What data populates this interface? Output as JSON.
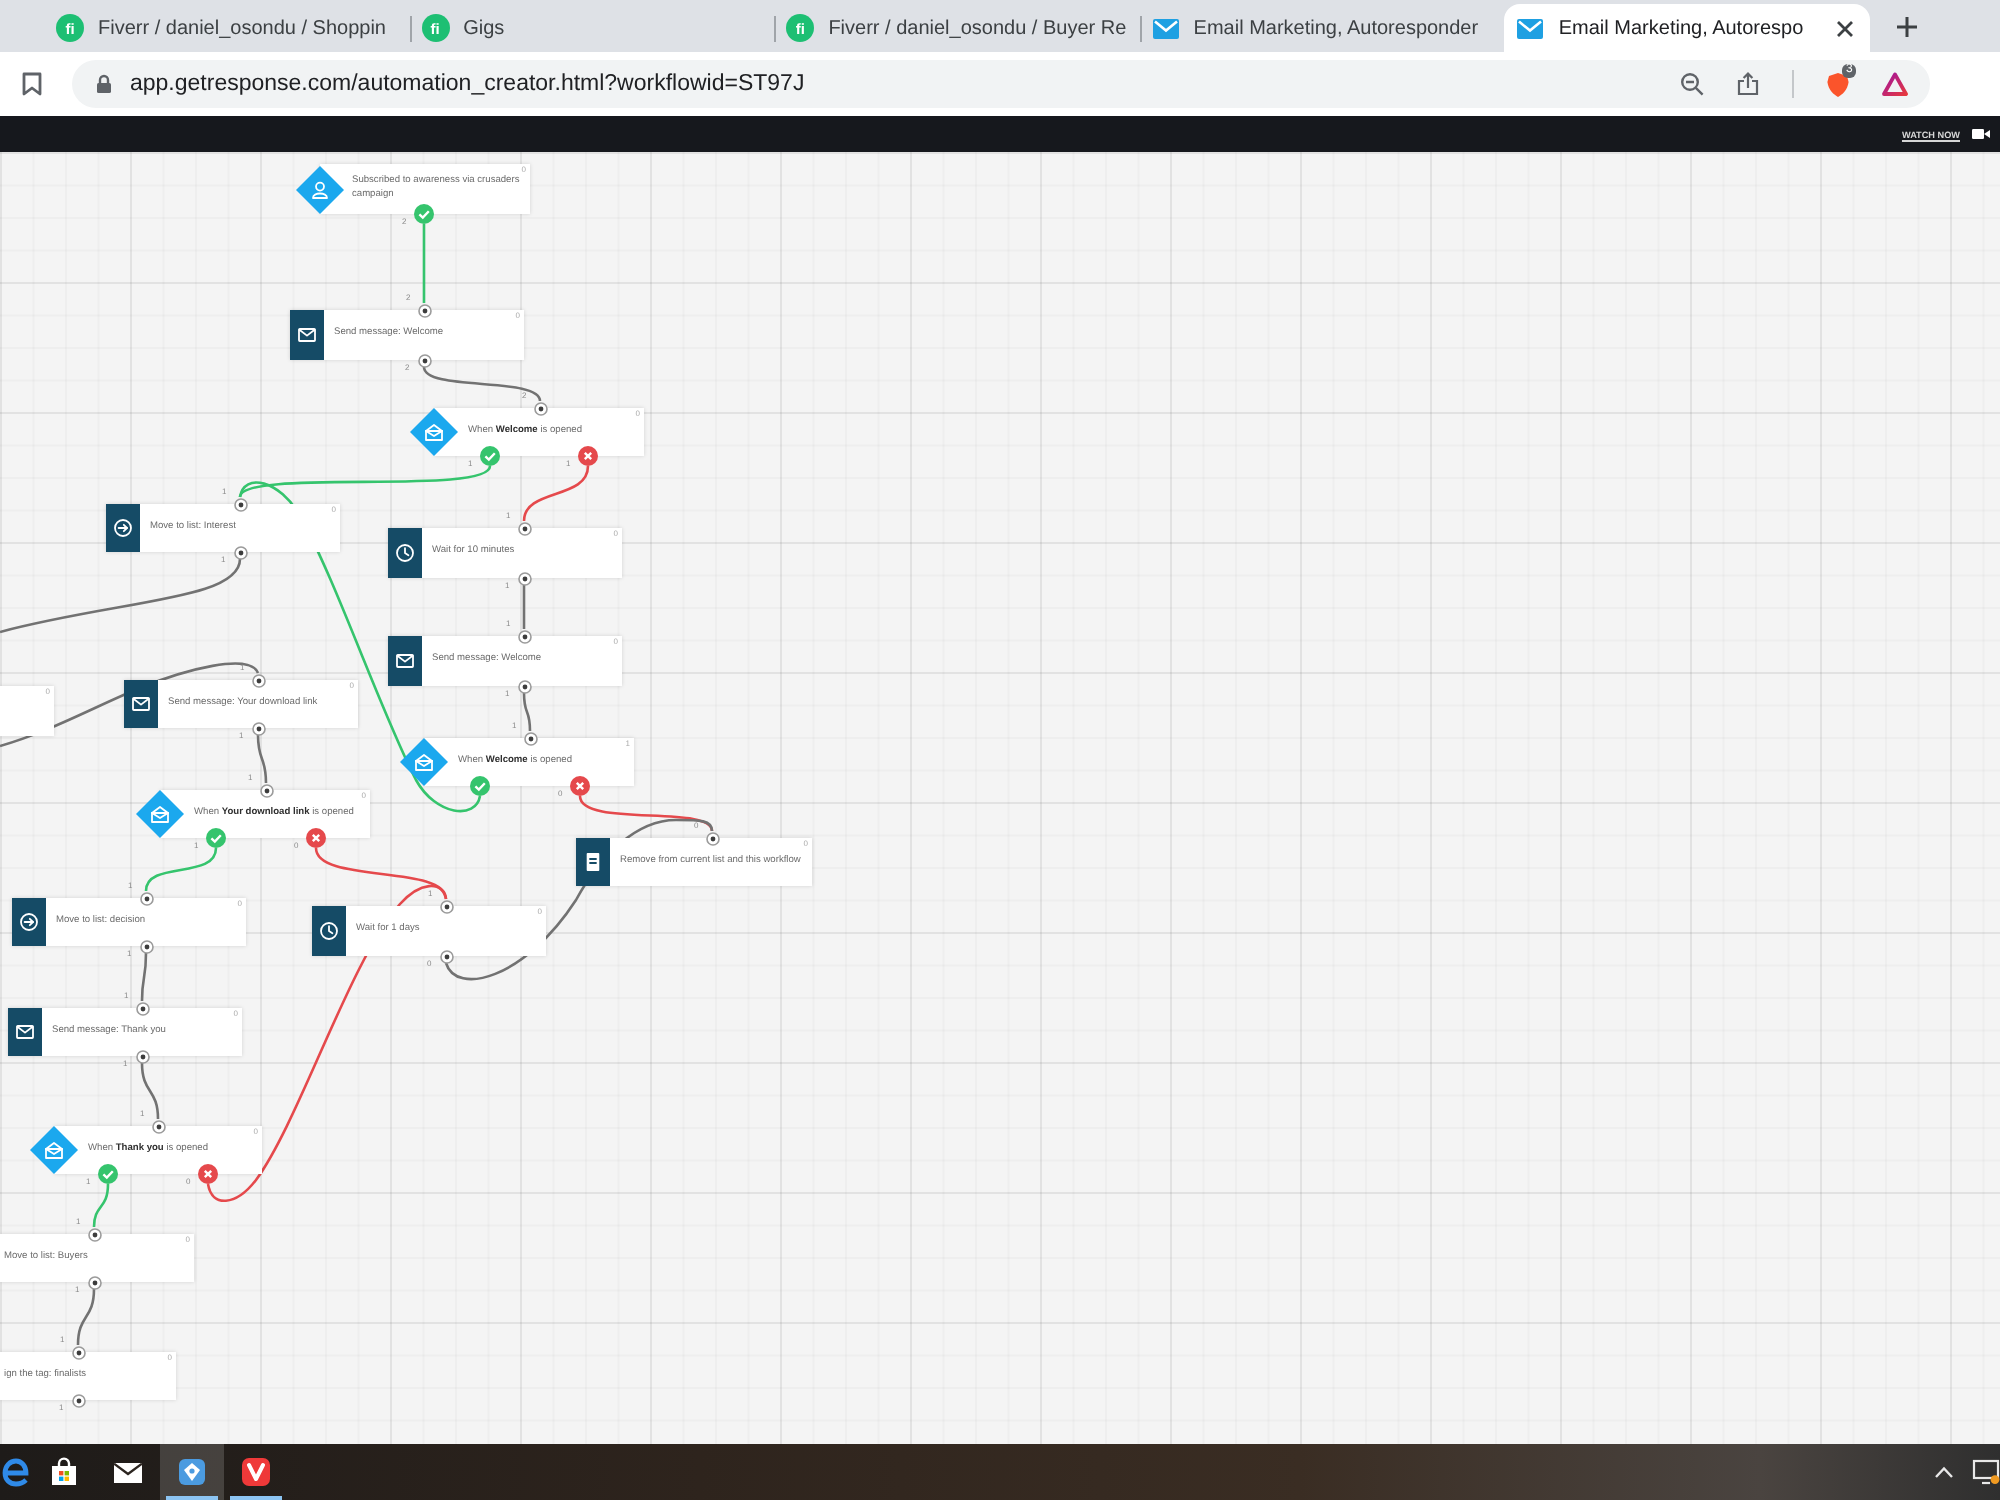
{
  "browser": {
    "tabs": [
      {
        "title": "Fiverr / daniel_osondu / Shoppin",
        "favicon": {
          "kind": "badge",
          "text": "fi"
        },
        "selected": false
      },
      {
        "title": "Gigs",
        "favicon": {
          "kind": "badge",
          "text": "fi"
        },
        "selected": false
      },
      {
        "title": "Fiverr / daniel_osondu / Buyer Re",
        "favicon": {
          "kind": "badge",
          "text": "fi"
        },
        "selected": false
      },
      {
        "title": "Email Marketing, Autoresponder",
        "favicon": {
          "kind": "envelope"
        },
        "selected": false
      },
      {
        "title": "Email Marketing, Autorespo",
        "favicon": {
          "kind": "envelope"
        },
        "selected": true
      }
    ],
    "address_bar": {
      "url": "app.getresponse.com/automation_creator.html?workflowid=ST97J",
      "extension_badge": "3"
    }
  },
  "top_bar": {
    "link": "WATCH NOW"
  },
  "workflow": {
    "nodes": [
      {
        "kind": "trigger",
        "label": "Subscribed to awareness via crusaders campaign",
        "count": "0",
        "outputs": [
          {
            "kind": "yes",
            "count": "2"
          }
        ]
      },
      {
        "kind": "action",
        "label": "Send message: Welcome",
        "count": "0",
        "input": {
          "count": "2"
        },
        "outputs": [
          {
            "kind": "next",
            "count": "2"
          }
        ]
      },
      {
        "kind": "condition",
        "label": "When **Welcome** is opened",
        "count": "0",
        "input": {
          "count": "2"
        },
        "outputs": [
          {
            "kind": "yes",
            "count": "1"
          },
          {
            "kind": "no",
            "count": "1"
          }
        ]
      },
      {
        "kind": "action",
        "label": "Move to list: Interest",
        "count": "0",
        "input": {
          "count": "1"
        },
        "outputs": [
          {
            "kind": "next",
            "count": "1"
          }
        ]
      },
      {
        "kind": "action",
        "label": "Wait for 10 minutes",
        "count": "0",
        "input": {
          "count": "1"
        },
        "outputs": [
          {
            "kind": "next",
            "count": "1"
          }
        ]
      },
      {
        "kind": "action",
        "count": "0",
        "outputs": [
          {
            "kind": "next"
          }
        ]
      },
      {
        "kind": "action",
        "label": "Send message: Your download link",
        "count": "0",
        "input": {
          "count": "1"
        },
        "outputs": [
          {
            "kind": "next",
            "count": "1"
          }
        ]
      },
      {
        "kind": "action",
        "label": "Send message: Welcome",
        "count": "0",
        "input": {
          "count": "1"
        },
        "outputs": [
          {
            "kind": "next",
            "count": "1"
          }
        ]
      },
      {
        "kind": "condition",
        "label": "When **Welcome** is opened",
        "count": "1",
        "input": {
          "count": "1"
        },
        "outputs": [
          {
            "kind": "yes"
          },
          {
            "kind": "no",
            "count": "0"
          }
        ]
      },
      {
        "kind": "condition",
        "label": "When **Your download link** is opened",
        "count": "0",
        "input": {
          "count": "1"
        },
        "outputs": [
          {
            "kind": "yes",
            "count": "1"
          },
          {
            "kind": "no",
            "count": "0"
          }
        ]
      },
      {
        "kind": "action",
        "label": "Remove from current list and this workflow",
        "count": "0",
        "input": {
          "count": "0"
        }
      },
      {
        "kind": "action",
        "label": "Move to list: decision",
        "count": "0",
        "input": {
          "count": "1"
        },
        "outputs": [
          {
            "kind": "next",
            "count": "1"
          }
        ]
      },
      {
        "kind": "action",
        "label": "Wait for 1 days",
        "count": "0",
        "input": {
          "count": "1"
        },
        "outputs": [
          {
            "kind": "next",
            "count": "0"
          }
        ]
      },
      {
        "kind": "action",
        "label": "Send message: Thank you",
        "count": "0",
        "input": {
          "count": "1"
        },
        "outputs": [
          {
            "kind": "next",
            "count": "1"
          }
        ]
      },
      {
        "kind": "condition",
        "label": "When **Thank you** is opened",
        "count": "0",
        "input": {
          "count": "1"
        },
        "outputs": [
          {
            "kind": "yes",
            "count": "1"
          },
          {
            "kind": "no",
            "count": "0"
          }
        ]
      },
      {
        "kind": "action",
        "label": "Move to list: Buyers",
        "count": "0",
        "input": {
          "count": "1"
        },
        "outputs": [
          {
            "kind": "next",
            "count": "1"
          }
        ]
      },
      {
        "kind": "action",
        "label": "ign the tag: finalists",
        "count": "0",
        "input": {
          "count": "1"
        },
        "outputs": [
          {
            "kind": "next",
            "count": "1"
          }
        ]
      }
    ]
  },
  "taskbar": {
    "apps": [
      {
        "kind": "browser",
        "selected": false,
        "running": false
      },
      {
        "kind": "store",
        "selected": false,
        "running": false
      },
      {
        "kind": "mail",
        "selected": false,
        "running": false
      },
      {
        "kind": "utility",
        "selected": true,
        "running": true
      },
      {
        "kind": "browser_alt",
        "selected": false,
        "running": true
      }
    ]
  }
}
